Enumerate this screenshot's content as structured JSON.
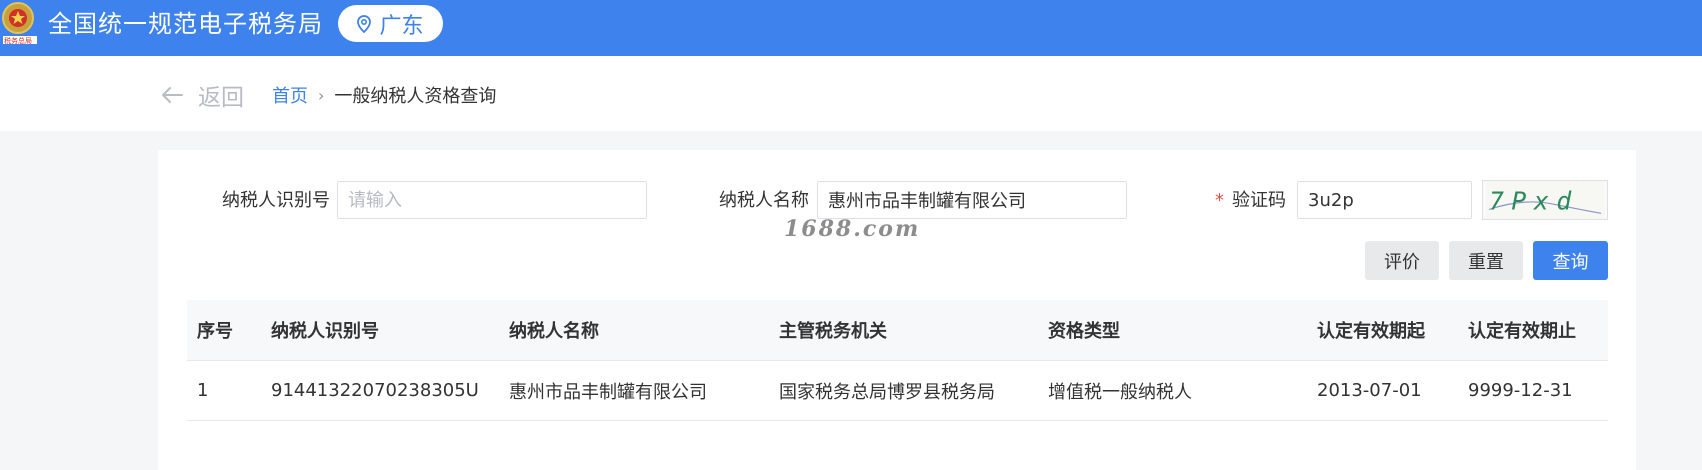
{
  "header": {
    "site_title": "全国统一规范电子税务局",
    "region": "广东",
    "location_icon": "location-pin-icon",
    "emblem_icon": "tax-emblem-icon",
    "accent_color": "#3e82ee"
  },
  "nav": {
    "back_label": "返回",
    "back_icon": "arrow-left-icon",
    "breadcrumb": {
      "home": "首页",
      "separator": "›",
      "current": "一般纳税人资格查询"
    }
  },
  "form": {
    "taxpayer_id": {
      "label": "纳税人识别号",
      "value": "",
      "placeholder": "请输入"
    },
    "taxpayer_name": {
      "label": "纳税人名称",
      "value": "惠州市品丰制罐有限公司"
    },
    "captcha": {
      "required_mark": "*",
      "label": "验证码",
      "value": "3u2p",
      "image_text": "7Pxd"
    },
    "watermark": "1688.com"
  },
  "actions": {
    "evaluate": "评价",
    "reset": "重置",
    "query": "查询"
  },
  "table": {
    "columns": [
      "序号",
      "纳税人识别号",
      "纳税人名称",
      "主管税务机关",
      "资格类型",
      "认定有效期起",
      "认定有效期止"
    ],
    "rows": [
      [
        "1",
        "91441322070238305U",
        "惠州市品丰制罐有限公司",
        "国家税务总局博罗县税务局",
        "增值税一般纳税人",
        "2013-07-01",
        "9999-12-31"
      ]
    ]
  }
}
